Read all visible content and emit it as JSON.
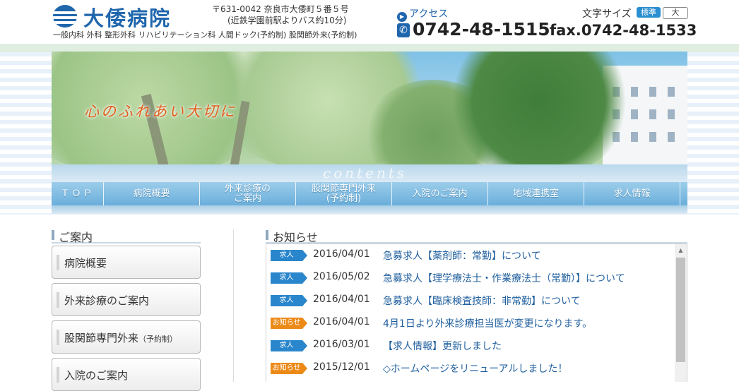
{
  "header": {
    "logo_text": "大倭病院",
    "departments": "一般内科 外科 整形外科 リハビリテーション科 人間ドック(予約制) 股関節外来(予約制)",
    "address_line1": "〒631-0042 奈良市大倭町５番５号",
    "address_line2": "(近鉄学園前駅よりバス約10分)",
    "access_label": "アクセス",
    "tel": "0742-48-1515",
    "fax": "fax.0742-48-1533",
    "font_size_label": "文字サイズ",
    "font_size_standard": "標準",
    "font_size_large": "大"
  },
  "hero": {
    "slogan": "心のふれあい大切に",
    "overlay_word": "contents"
  },
  "nav": {
    "items": [
      {
        "label": "ＴＯＰ"
      },
      {
        "label": "病院概要"
      },
      {
        "label": "外来診療の\nご案内"
      },
      {
        "label": "股関節専門外来\n(予約制)"
      },
      {
        "label": "入院のご案内"
      },
      {
        "label": "地域連携室"
      },
      {
        "label": "求人情報"
      }
    ]
  },
  "sidebar": {
    "title": "ご案内",
    "items": [
      {
        "label": "病院概要"
      },
      {
        "label": "外来診療のご案内"
      },
      {
        "label": "股関節専門外来",
        "sub": "（予約制）"
      },
      {
        "label": "入院のご案内"
      }
    ]
  },
  "news": {
    "title": "お知らせ",
    "items": [
      {
        "badge": "求人",
        "type": "kyujin",
        "date": "2016/04/01",
        "text": "急募求人【薬剤師：常勤】について"
      },
      {
        "badge": "求人",
        "type": "kyujin",
        "date": "2016/05/02",
        "text": "急募求人【理学療法士・作業療法士（常勤）】について"
      },
      {
        "badge": "求人",
        "type": "kyujin",
        "date": "2016/04/01",
        "text": "急募求人【臨床検査技師：非常勤】について"
      },
      {
        "badge": "お知らせ",
        "type": "info",
        "date": "2016/04/01",
        "text": "4月1日より外来診療担当医が変更になります。"
      },
      {
        "badge": "求人",
        "type": "kyujin",
        "date": "2016/03/01",
        "text": "【求人情報】更新しました"
      },
      {
        "badge": "お知らせ",
        "type": "info",
        "date": "2015/12/01",
        "text": "◇ホームページをリニューアルしました！"
      }
    ]
  },
  "colors": {
    "brand_blue": "#1f66ad",
    "badge_job": "#2a86cc",
    "badge_info": "#ec8a18",
    "slogan_orange": "#e0601f"
  }
}
